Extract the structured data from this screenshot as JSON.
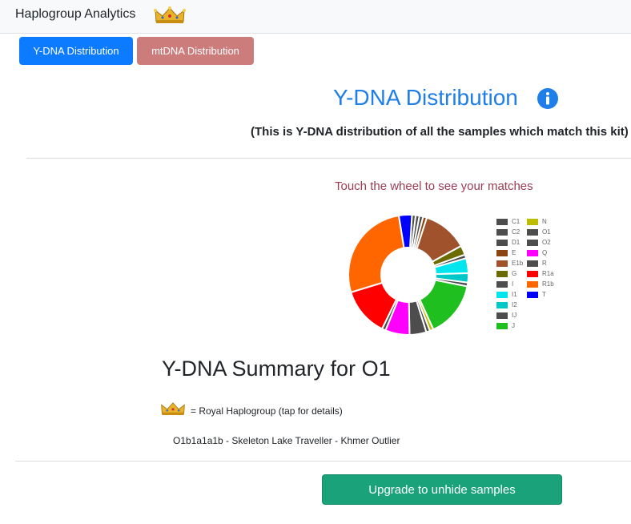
{
  "nav": {
    "brand": "Haplogroup Analytics"
  },
  "tabs": {
    "ydna_label": "Y-DNA Distribution",
    "mtdna_label": "mtDNA Distribution"
  },
  "header": {
    "title": "Y-DNA Distribution",
    "subtitle": "(This is Y-DNA distribution of all the samples which match this kit)"
  },
  "chart": {
    "prompt": "Touch the wheel to see your matches"
  },
  "summary": {
    "title": "Y-DNA Summary for O1",
    "royal_text": "= Royal Haplogroup (tap for details)",
    "match": "O1b1a1a1b - Skeleton Lake Traveller - Khmer Outlier"
  },
  "footer": {
    "upgrade_label": "Upgrade to unhide samples"
  },
  "icons": {
    "crown": "crown-icon",
    "info": "info-icon"
  },
  "colors": {
    "primary": "#0d7bff",
    "title": "#1f7ee8",
    "upgrade": "#1aa37a",
    "mtdna_button": "#cd7c7c",
    "prompt": "#9b3b55"
  },
  "chart_data": {
    "type": "pie",
    "donut": true,
    "legend_position": "right",
    "categories": [
      "C1",
      "C2",
      "D1",
      "E",
      "E1b",
      "G",
      "I",
      "I1",
      "I2",
      "IJ",
      "J",
      "N",
      "O1",
      "O2",
      "Q",
      "R",
      "R1a",
      "R1b",
      "T"
    ],
    "values": [
      1.0,
      1.0,
      1.0,
      1.0,
      12.0,
      2.5,
      1.0,
      4.0,
      2.5,
      1.0,
      15.0,
      1.0,
      1.0,
      4.5,
      6.5,
      1.0,
      13.0,
      27.0,
      3.5
    ],
    "colors": [
      "#4d4d4d",
      "#4d4d4d",
      "#4d4d4d",
      "#8b4513",
      "#a0522d",
      "#6b6b00",
      "#4d4d4d",
      "#00e5ee",
      "#00c8c8",
      "#4d4d4d",
      "#1fbf1f",
      "#bdbd00",
      "#4d4d4d",
      "#4d4d4d",
      "#ff00ff",
      "#4d4d4d",
      "#ff0000",
      "#ff6600",
      "#0000ff"
    ]
  }
}
